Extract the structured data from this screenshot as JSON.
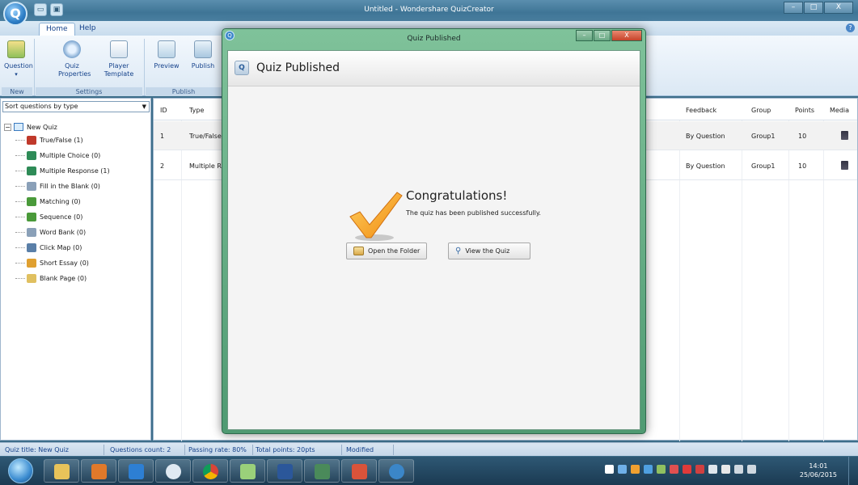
{
  "window": {
    "title": "Untitled - Wondershare QuizCreator",
    "controls": {
      "minimize": "–",
      "maximize": "□",
      "close": "X"
    }
  },
  "ribbon": {
    "tabs": [
      "Home",
      "Help"
    ],
    "buttons": {
      "question": "Question",
      "quiz_properties_1": "Quiz",
      "quiz_properties_2": "Properties",
      "player_template_1": "Player",
      "player_template_2": "Template",
      "preview": "Preview",
      "publish": "Publish"
    },
    "groups": {
      "new": "New",
      "settings": "Settings",
      "publish": "Publish"
    }
  },
  "left_pane": {
    "sort_value": "Sort questions by type",
    "root": "New Quiz",
    "items": [
      {
        "label": "True/False  (1)",
        "icon": "true-false-icon",
        "color": "#c0392b"
      },
      {
        "label": "Multiple Choice  (0)",
        "icon": "multiple-choice-icon",
        "color": "#2e8b57"
      },
      {
        "label": "Multiple Response  (1)",
        "icon": "multiple-response-icon",
        "color": "#2e8b57"
      },
      {
        "label": "Fill in the Blank  (0)",
        "icon": "fill-blank-icon",
        "color": "#8aa0b8"
      },
      {
        "label": "Matching  (0)",
        "icon": "matching-icon",
        "color": "#4a9a3a"
      },
      {
        "label": "Sequence  (0)",
        "icon": "sequence-icon",
        "color": "#4a9a3a"
      },
      {
        "label": "Word Bank  (0)",
        "icon": "word-bank-icon",
        "color": "#8aa0b8"
      },
      {
        "label": "Click Map  (0)",
        "icon": "click-map-icon",
        "color": "#5a7fa8"
      },
      {
        "label": "Short Essay  (0)",
        "icon": "short-essay-icon",
        "color": "#e0a030"
      },
      {
        "label": "Blank Page  (0)",
        "icon": "blank-page-icon",
        "color": "#e0c060"
      }
    ]
  },
  "grid": {
    "headers": {
      "id": "ID",
      "type": "Type",
      "feedback": "Feedback",
      "group": "Group",
      "points": "Points",
      "media": "Media"
    },
    "rows": [
      {
        "id": "1",
        "type": "True/False",
        "feedback": "By Question",
        "group": "Group1",
        "points": "10"
      },
      {
        "id": "2",
        "type": "Multiple Re",
        "feedback": "By Question",
        "group": "Group1",
        "points": "10"
      }
    ]
  },
  "dialog": {
    "window_title": "Quiz Published",
    "header": "Quiz  Published",
    "congrats": "Congratulations!",
    "message": "The quiz has been published successfully.",
    "btn_open_folder": "Open the Folder",
    "btn_view_quiz": "View the Quiz"
  },
  "status": {
    "title": "Quiz title: New Quiz",
    "count": "Questions count: 2",
    "passing": "Passing rate: 80%",
    "points": "Total points: 20pts",
    "modified": "Modified"
  },
  "taskbar": {
    "time": "14:01",
    "date": "25/06/2015"
  }
}
